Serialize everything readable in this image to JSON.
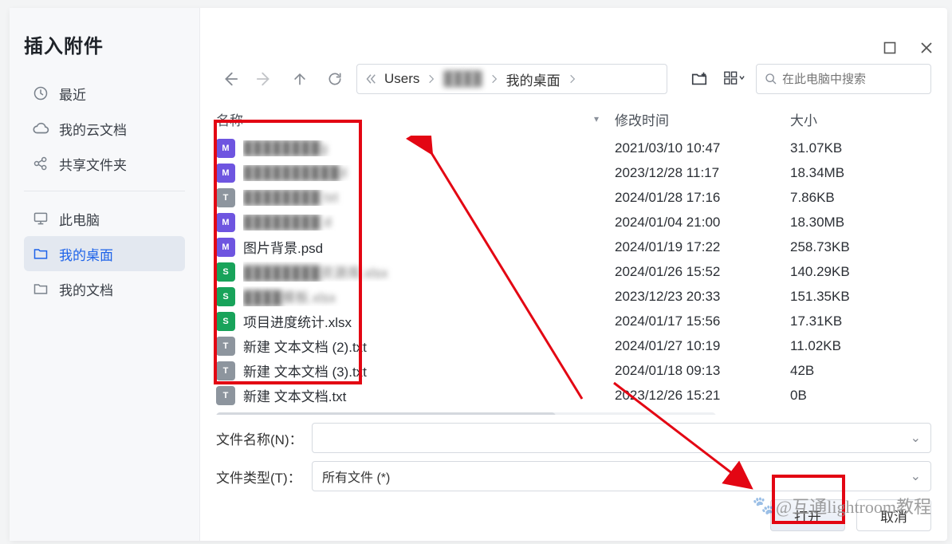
{
  "dialog": {
    "title": "插入附件"
  },
  "sidebar": {
    "items": [
      {
        "label": "最近",
        "icon": "clock-icon"
      },
      {
        "label": "我的云文档",
        "icon": "cloud-icon"
      },
      {
        "label": "共享文件夹",
        "icon": "share-icon"
      },
      {
        "label": "此电脑",
        "icon": "monitor-icon"
      },
      {
        "label": "我的桌面",
        "icon": "folder-icon"
      },
      {
        "label": "我的文档",
        "icon": "folder-icon"
      }
    ],
    "selected_index": 4
  },
  "toolbar": {
    "breadcrumb": [
      "Users",
      "████",
      "我的桌面"
    ],
    "search_placeholder": "在此电脑中搜索"
  },
  "columns": {
    "name": "名称",
    "time": "修改时间",
    "size": "大小"
  },
  "files": [
    {
      "name": "████████g",
      "type": "psd",
      "blur": true,
      "time": "2021/03/10 10:47",
      "size": "31.07KB"
    },
    {
      "name": "██████████d",
      "type": "psd",
      "blur": true,
      "time": "2023/12/28 11:17",
      "size": "18.34MB"
    },
    {
      "name": "████████ txt",
      "type": "txt",
      "blur": true,
      "time": "2024/01/28 17:16",
      "size": "7.86KB"
    },
    {
      "name": "████████ d",
      "type": "psd",
      "blur": true,
      "time": "2024/01/04 21:00",
      "size": "18.30MB"
    },
    {
      "name": "图片背景.psd",
      "type": "psd",
      "blur": false,
      "time": "2024/01/19 17:22",
      "size": "258.73KB"
    },
    {
      "name": "████████资源库.xlsx",
      "type": "xls",
      "blur": true,
      "time": "2024/01/26 15:52",
      "size": "140.29KB"
    },
    {
      "name": "████模板.xlsx",
      "type": "xls",
      "blur": true,
      "time": "2023/12/23 20:33",
      "size": "151.35KB"
    },
    {
      "name": "项目进度统计.xlsx",
      "type": "xls",
      "blur": false,
      "time": "2024/01/17 15:56",
      "size": "17.31KB"
    },
    {
      "name": "新建 文本文档 (2).txt",
      "type": "txt",
      "blur": false,
      "time": "2024/01/27 10:19",
      "size": "11.02KB"
    },
    {
      "name": "新建 文本文档 (3).txt",
      "type": "txt",
      "blur": false,
      "time": "2024/01/18 09:13",
      "size": "42B"
    },
    {
      "name": "新建 文本文档.txt",
      "type": "txt",
      "blur": false,
      "time": "2023/12/26 15:21",
      "size": "0B"
    }
  ],
  "bottom": {
    "filename_label": "文件名称(N)：",
    "filename_value": "",
    "filetype_label": "文件类型(T)：",
    "filetype_value": "所有文件 (*)",
    "open_label": "打开",
    "cancel_label": "取消"
  },
  "watermark": "@互通lightroom教程"
}
